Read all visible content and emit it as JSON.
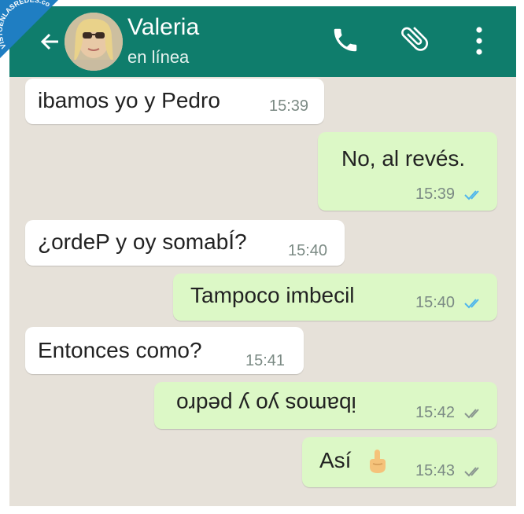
{
  "header": {
    "contact_name": "Valeria",
    "status": "en línea",
    "color": "#0f7d6c"
  },
  "icons": [
    "back-arrow-icon",
    "phone-icon",
    "paperclip-icon",
    "more-options-icon",
    "double-check-icon",
    "raised-finger-emoji"
  ],
  "watermark": "VISTOENLASREDES.com",
  "messages": [
    {
      "text": "ibamos yo y Pedro",
      "time": "15:39",
      "from": "contact"
    },
    {
      "text": "No, al revés.",
      "time": "15:39",
      "from": "me",
      "read": true
    },
    {
      "text": "¿ordeP y oy somabÍ?",
      "time": "15:40",
      "from": "contact"
    },
    {
      "text": "Tampoco imbecil",
      "time": "15:40",
      "from": "me",
      "read": true
    },
    {
      "text": "Entonces como?",
      "time": "15:41",
      "from": "contact"
    },
    {
      "text": "ibamos yo y pedro",
      "time": "15:42",
      "from": "me",
      "read": false,
      "upside_down": true
    },
    {
      "text": "Así",
      "time": "15:43",
      "from": "me",
      "read": false
    }
  ],
  "colors": {
    "incoming": "#ffffff",
    "outgoing": "#dcf8c6",
    "read_ticks": "#4fb6ec",
    "unread_ticks": "#8a9690"
  }
}
